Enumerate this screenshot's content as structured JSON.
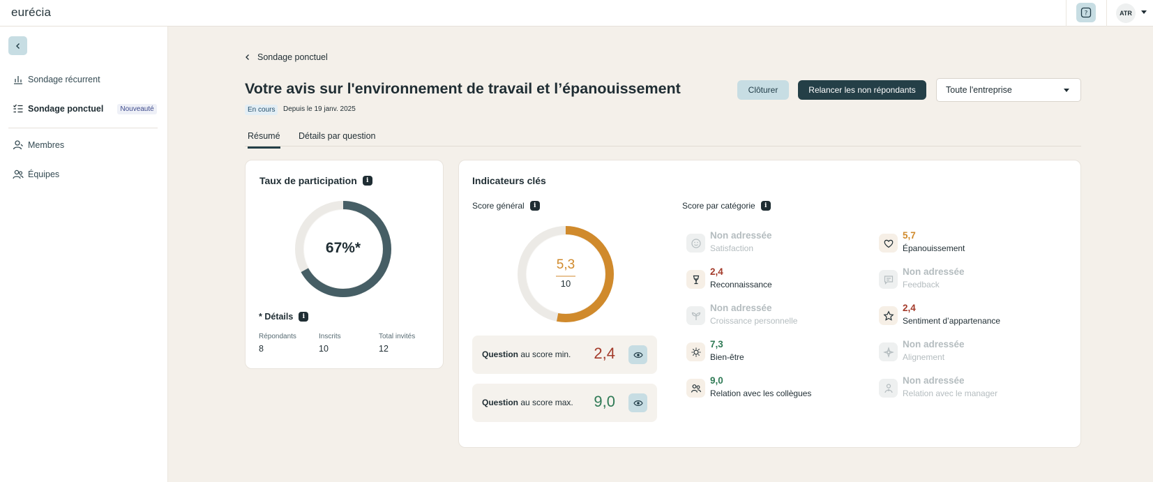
{
  "app": {
    "logo": "eurécia"
  },
  "topbar": {
    "avatar_initials": "ATR",
    "help_icon": "help-icon"
  },
  "sidebar": {
    "items": [
      {
        "label": "Sondage récurrent",
        "icon": "bar-chart-icon"
      },
      {
        "label": "Sondage ponctuel",
        "icon": "checklist-icon",
        "badge": "Nouveauté",
        "active": true
      },
      {
        "label": "Membres",
        "icon": "user-icon"
      },
      {
        "label": "Équipes",
        "icon": "users-icon"
      }
    ]
  },
  "header": {
    "breadcrumb": "Sondage ponctuel",
    "title": "Votre avis sur l'environnement de travail et l’épanouissement",
    "status": "En cours",
    "since": "Depuis le 19 janv. 2025",
    "actions": {
      "close_label": "Clôturer",
      "remind_label": "Relancer les non répondants"
    },
    "scope_select": {
      "value": "Toute l'entreprise"
    }
  },
  "tabs": [
    {
      "label": "Résumé",
      "active": true
    },
    {
      "label": "Détails par question",
      "active": false
    }
  ],
  "participation": {
    "title": "Taux de participation",
    "rate_label": "67%*",
    "rate_fraction": 0.67,
    "details_title": "* Détails",
    "stats": [
      {
        "label": "Répondants",
        "value": "8"
      },
      {
        "label": "Inscrits",
        "value": "10"
      },
      {
        "label": "Total invités",
        "value": "12"
      }
    ]
  },
  "indicators": {
    "title": "Indicateurs clés",
    "general": {
      "title": "Score général",
      "score": "5,3",
      "max": "10",
      "fraction": 0.53
    },
    "min_question": {
      "label_bold": "Question",
      "label_rest": " au score min.",
      "score": "2,4"
    },
    "max_question": {
      "label_bold": "Question",
      "label_rest": " au score max.",
      "score": "9,0"
    },
    "category_title": "Score par catégorie",
    "categories": [
      {
        "score": "Non adressée",
        "name": "Satisfaction",
        "icon": "smiley-icon",
        "disabled": true
      },
      {
        "score": "5,7",
        "name": "Épanouissement",
        "icon": "heart-icon",
        "color": "#d08a2c"
      },
      {
        "score": "2,4",
        "name": "Reconnaissance",
        "icon": "trophy-icon",
        "color": "#a33a2a"
      },
      {
        "score": "Non adressée",
        "name": "Feedback",
        "icon": "chat-icon",
        "disabled": true
      },
      {
        "score": "Non adressée",
        "name": "Croissance personnelle",
        "icon": "sprout-icon",
        "disabled": true
      },
      {
        "score": "2,4",
        "name": "Sentiment d’appartenance",
        "icon": "star-icon",
        "color": "#a33a2a"
      },
      {
        "score": "7,3",
        "name": "Bien-être",
        "icon": "sun-icon",
        "color": "#2f7a55"
      },
      {
        "score": "Non adressée",
        "name": "Alignement",
        "icon": "compass-icon",
        "disabled": true
      },
      {
        "score": "9,0",
        "name": "Relation avec les collègues",
        "icon": "people-icon",
        "color": "#2f7a55"
      },
      {
        "score": "Non adressée",
        "name": "Relation avec le manager",
        "icon": "manager-icon",
        "disabled": true
      }
    ]
  },
  "colors": {
    "accent_dark": "#243f47",
    "accent_light": "#c7dde3",
    "orange": "#d08a2c",
    "red": "#a33a2a",
    "green": "#2f7a55"
  }
}
